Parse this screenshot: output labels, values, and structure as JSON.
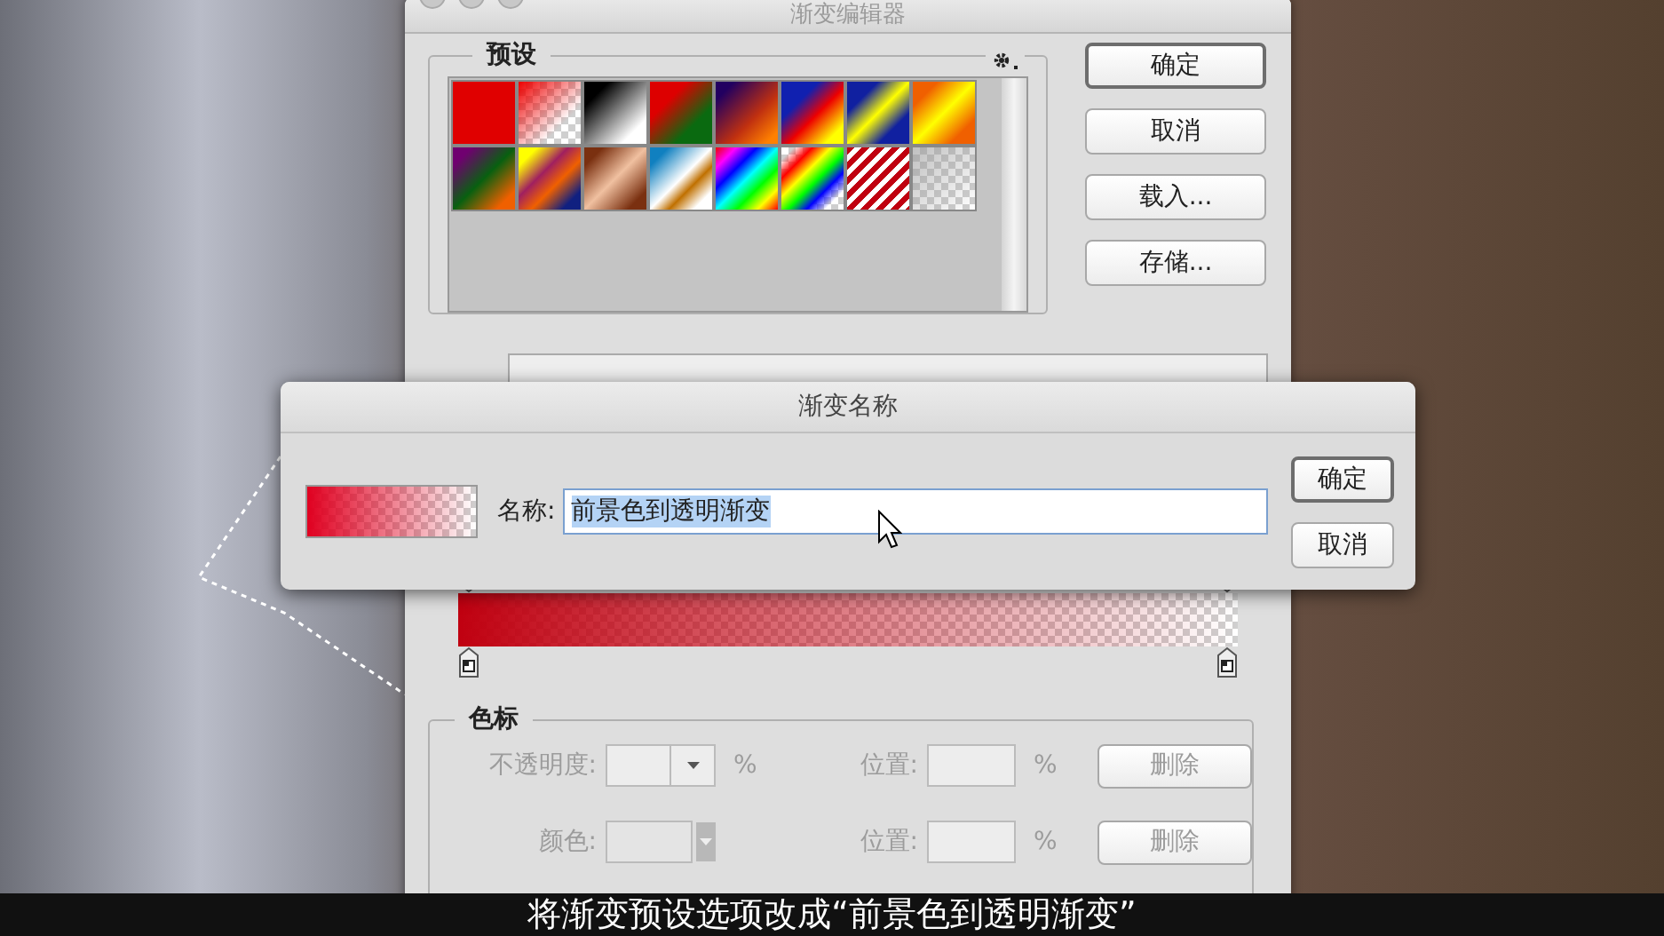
{
  "editor": {
    "title": "渐变编辑器",
    "presets": {
      "label": "预设"
    },
    "buttons": [
      {
        "label": "确定",
        "default": true
      },
      {
        "label": "取消",
        "default": false
      },
      {
        "label": "载入...",
        "default": false
      },
      {
        "label": "存储...",
        "default": false
      }
    ],
    "stops": {
      "label": "色标",
      "rows": [
        {
          "kind": "opacity",
          "label": "不透明度:",
          "unit": "%",
          "position_label": "位置:",
          "position_unit": "%",
          "delete": "删除",
          "disabled": true
        },
        {
          "kind": "color",
          "label": "颜色:",
          "unit": "",
          "position_label": "位置:",
          "position_unit": "%",
          "delete": "删除",
          "disabled": true
        }
      ]
    }
  },
  "name_dialog": {
    "title": "渐变名称",
    "label": "名称:",
    "value": "前景色到透明渐变",
    "value_selected": true,
    "buttons": [
      {
        "label": "确定",
        "default": true
      },
      {
        "label": "取消",
        "default": false
      }
    ]
  },
  "subtitle": "将渐变预设选项改成“前景色到透明渐变”"
}
